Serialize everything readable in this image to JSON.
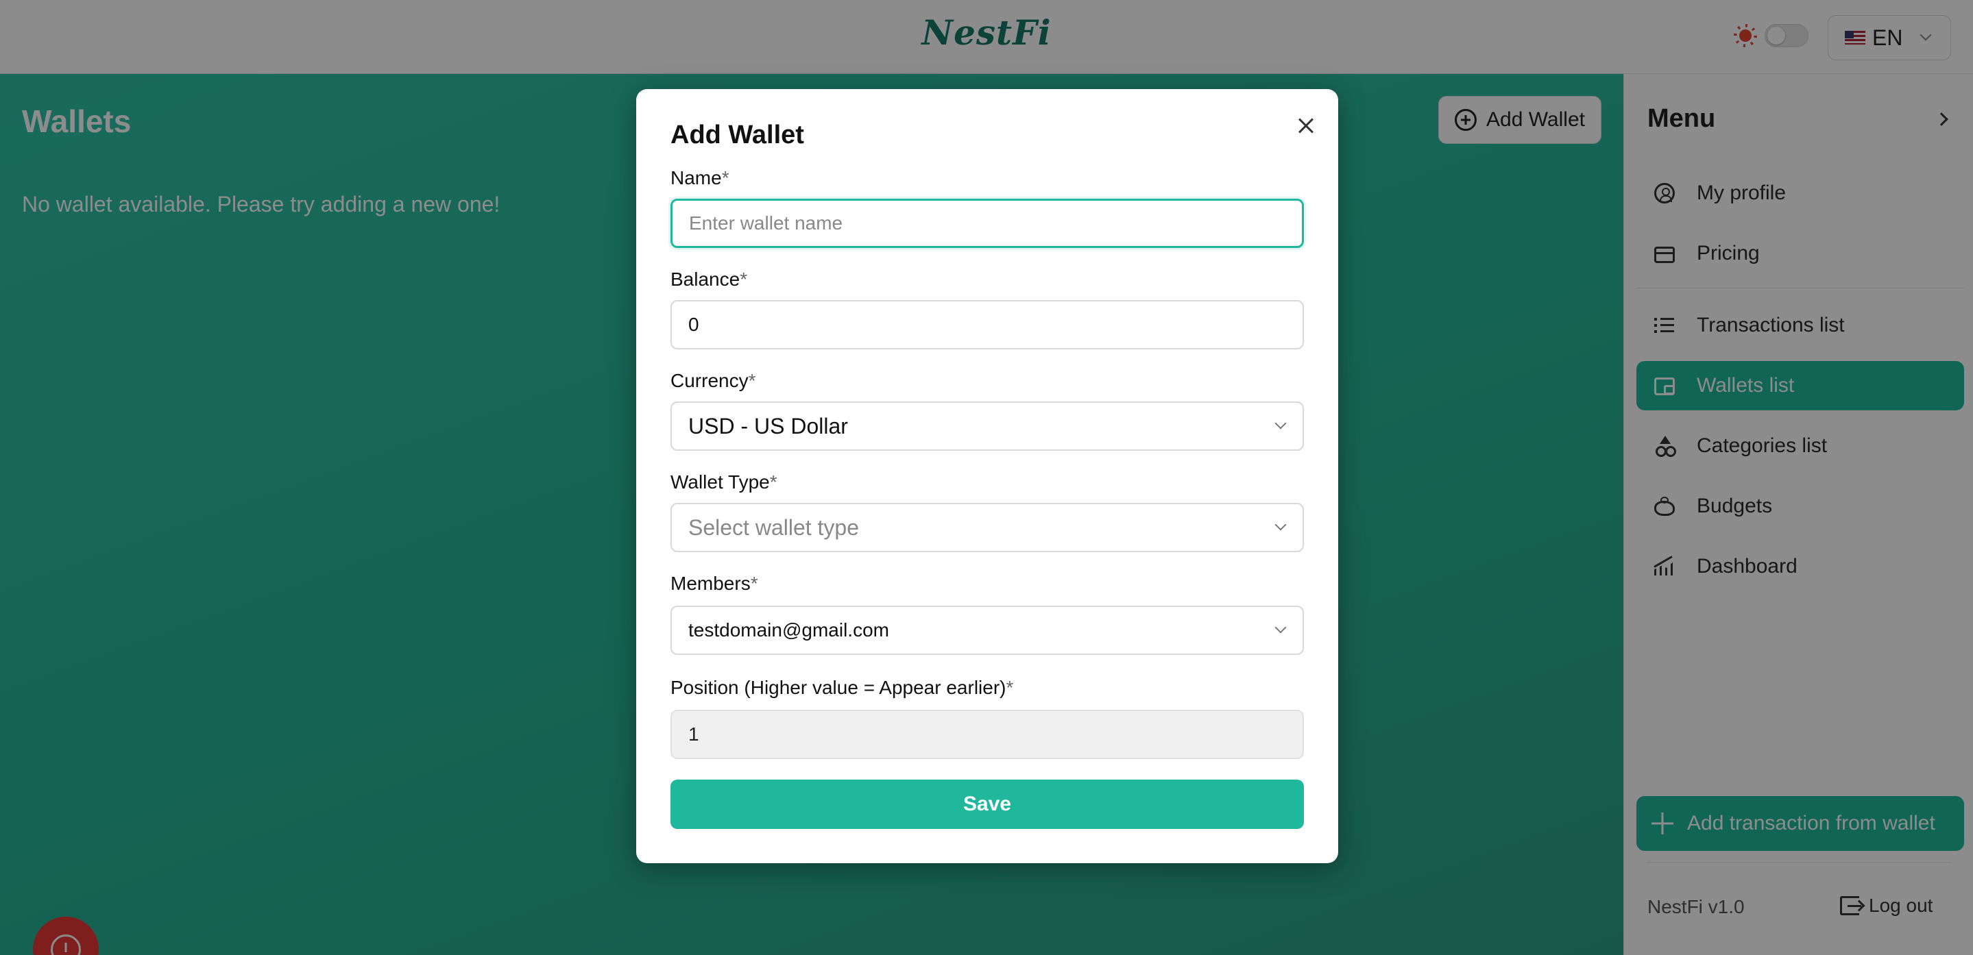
{
  "header": {
    "brand": "NestFi",
    "language": {
      "flag": "us-flag-icon",
      "label": "EN"
    }
  },
  "main": {
    "title": "Wallets",
    "add_wallet_label": "Add Wallet",
    "empty_message": "No wallet available. Please try adding a new one!"
  },
  "sidebar": {
    "title": "Menu",
    "items": [
      {
        "label": "My profile",
        "icon": "user-circle-icon",
        "active": false
      },
      {
        "label": "Pricing",
        "icon": "credit-card-icon",
        "active": false
      },
      {
        "label": "Transactions list",
        "icon": "list-icon",
        "active": false
      },
      {
        "label": "Wallets list",
        "icon": "wallet-icon",
        "active": true
      },
      {
        "label": "Categories list",
        "icon": "shapes-icon",
        "active": false
      },
      {
        "label": "Budgets",
        "icon": "piggy-bank-icon",
        "active": false
      },
      {
        "label": "Dashboard",
        "icon": "chart-icon",
        "active": false
      }
    ],
    "cta_label": "Add transaction from wallet",
    "version": "NestFi v1.0",
    "logout_label": "Log out"
  },
  "modal": {
    "title": "Add Wallet",
    "fields": {
      "name": {
        "label": "Name",
        "required": "*",
        "value": "",
        "placeholder": "Enter wallet name"
      },
      "balance": {
        "label": "Balance",
        "required": "*",
        "value": "0"
      },
      "currency": {
        "label": "Currency",
        "required": "*",
        "value": "USD - US Dollar"
      },
      "wallet_type": {
        "label": "Wallet Type",
        "required": "*",
        "placeholder": "Select wallet type"
      },
      "members": {
        "label": "Members",
        "required": "*",
        "value": "testdomain@gmail.com"
      },
      "position": {
        "label": "Position (Higher value = Appear earlier)",
        "required": "*",
        "value": "1"
      }
    },
    "save_label": "Save"
  },
  "colors": {
    "accent": "#1fb89c",
    "brand": "#157a68",
    "danger": "#e53935"
  }
}
